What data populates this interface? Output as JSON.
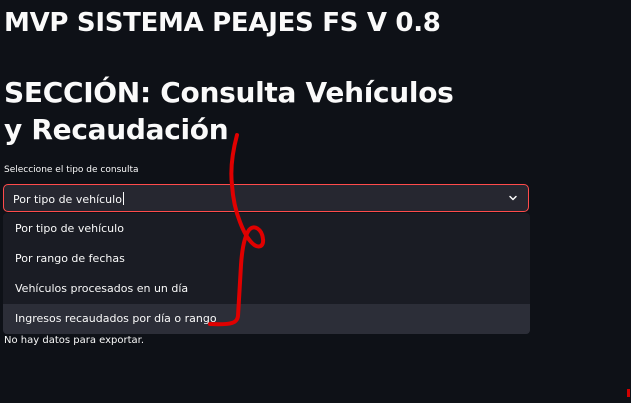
{
  "header": {
    "app_title": "MVP SISTEMA PEAJES FS V 0.8",
    "section_title": "SECCIÓN: Consulta Vehículos y Recaudación"
  },
  "query_select": {
    "label": "Seleccione el tipo de consulta",
    "selected_value": "Por tipo de vehículo",
    "options": [
      "Por tipo de vehículo",
      "Por rango de fechas",
      "Vehículos procesados en un día",
      "Ingresos recaudados por día o rango"
    ],
    "hovered_option": "Ingresos recaudados por día o rango"
  },
  "export": {
    "empty_message": "No hay datos para exportar."
  },
  "icons": {
    "select_toggle": "chevron-down-icon"
  },
  "colors": {
    "background": "#0e1117",
    "select_border": "#ff4b4b",
    "annotation": "#e00000"
  }
}
